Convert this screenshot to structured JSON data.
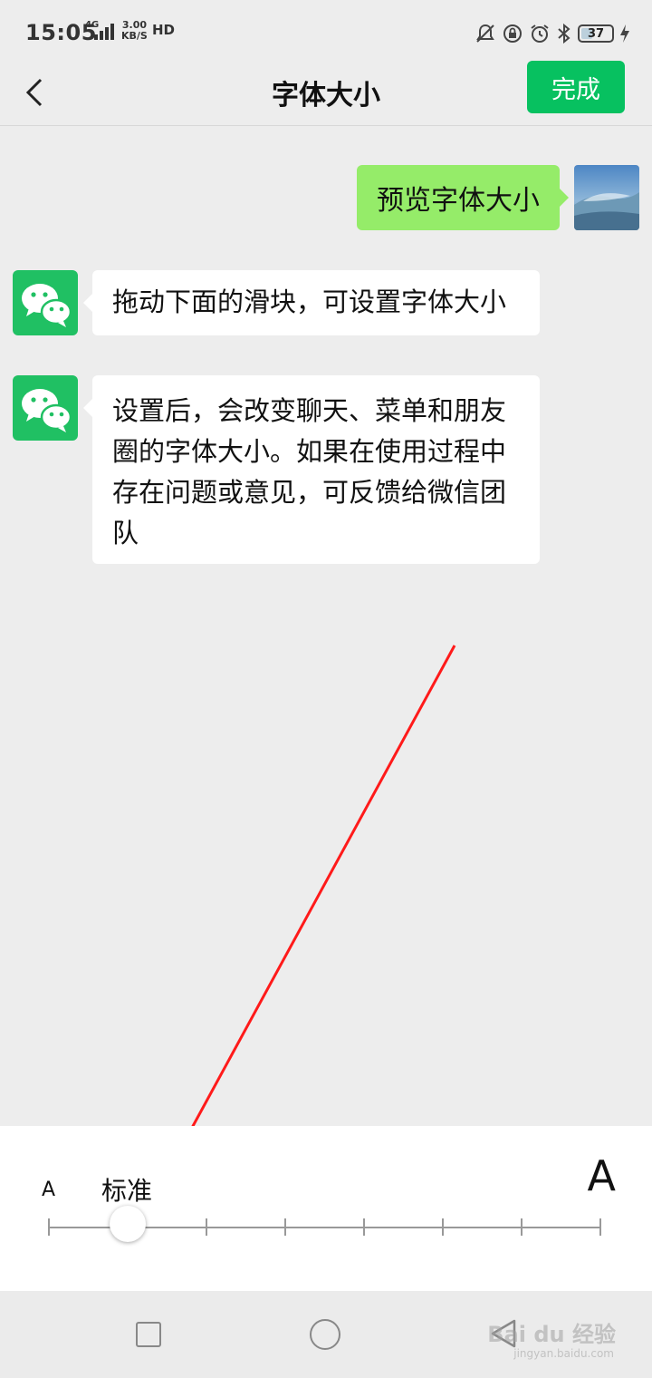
{
  "status_bar": {
    "time": "15:05",
    "network": "4G",
    "speed_value": "3.00",
    "speed_unit": "KB/S",
    "hd": "HD",
    "battery": "37",
    "icons": [
      "mute-icon",
      "rotation-lock-icon",
      "alarm-icon",
      "bluetooth-icon",
      "battery-icon",
      "charging-icon"
    ]
  },
  "header": {
    "title": "字体大小",
    "done_label": "完成",
    "back_icon": "chevron-left-icon"
  },
  "messages": {
    "sent": "预览字体大小",
    "received_1": "拖动下面的滑块，可设置字体大小",
    "received_2": "设置后，会改变聊天、菜单和朋友圈的字体大小。如果在使用过程中存在问题或意见，可反馈给微信团队"
  },
  "font_slider": {
    "min_label": "A",
    "current_label": "标准",
    "max_label": "A",
    "levels": 8,
    "selected_level": 2
  },
  "watermark": {
    "brand": "Bai du 经验",
    "url": "jingyan.baidu.com"
  },
  "colors": {
    "accent": "#07c160",
    "sent_bubble": "#95ec69",
    "background": "#ededed",
    "annotation_arrow": "#ff1a1a"
  }
}
